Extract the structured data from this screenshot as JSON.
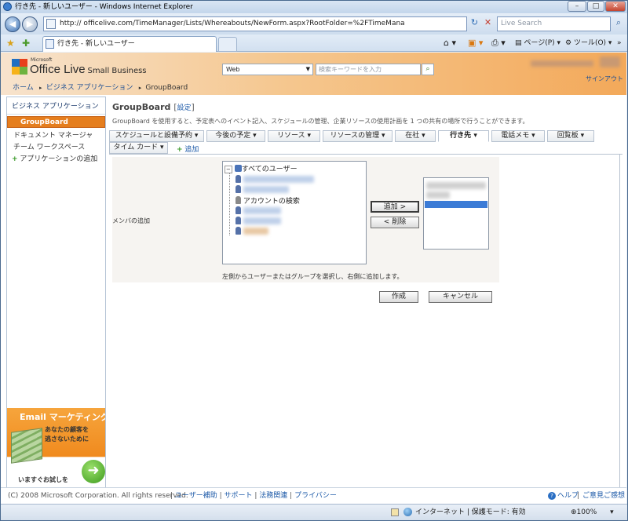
{
  "browser": {
    "title": "行き先 - 新しいユーザー - Windows Internet Explorer",
    "address": "http://                    officelive.com/TimeManager/Lists/Whereabouts/NewForm.aspx?RootFolder=%2FTimeMana",
    "search_placeholder": "Live Search",
    "tab_title": "行き先 - 新しいユーザー",
    "toolbar": {
      "page": "ページ(P)",
      "tools": "ツール(O)"
    },
    "window_buttons": {
      "min": "–",
      "max": "□",
      "close": "✕"
    }
  },
  "site": {
    "logo_small": "Microsoft",
    "logo_main": "Office Live",
    "logo_sub": "Small Business",
    "search_scope": "Web",
    "search_placeholder": "検索キーワードを入力",
    "signout": "サインアウト",
    "breadcrumb": [
      "ホーム",
      "ビジネス アプリケーション",
      "GroupBoard"
    ]
  },
  "sidebar": {
    "heading": "ビジネス アプリケーション",
    "items": [
      "GroupBoard",
      "ドキュメント マネージャ",
      "チーム ワークスペース"
    ],
    "add_app": "アプリケーションの追加"
  },
  "promo": {
    "title": "Email マーケティング",
    "line1": "あなたの顧客を",
    "line2": "逃さないために",
    "cta": "いますぐお試しを"
  },
  "main": {
    "title": "GroupBoard",
    "settings": "設定",
    "description": "GroupBoard を使用すると、予定表へのイベント記入、スケジュールの管理、企業リソースの使用計画を 1 つの共有の場所で行うことができます。",
    "tabs_row1": [
      "スケジュールと設備予約",
      "今後の予定",
      "リソース",
      "リソースの管理",
      "在社",
      "行き先",
      "電話メモ",
      "回覧板"
    ],
    "tabs_row2": [
      "タイム カード"
    ],
    "add_tab": "追加"
  },
  "form": {
    "label": "メンバの追加",
    "tree_root": "すべてのユーザー",
    "tree_search": "アカウントの検索",
    "add_btn": "追加 >",
    "remove_btn": "< 削除",
    "hint": "左側からユーザーまたはグループを選択し、右側に追加します。",
    "create_btn": "作成",
    "cancel_btn": "キャンセル"
  },
  "footer": {
    "copyright": "(C) 2008 Microsoft Corporation. All rights reserved.",
    "links": [
      "ユーザー補助",
      "サポート",
      "法務関連",
      "プライバシー"
    ],
    "help": "ヘルプ",
    "feedback": "ご意見ご感想"
  },
  "statusbar": {
    "zone": "インターネット | 保護モード: 有効",
    "zoom": "100%"
  }
}
